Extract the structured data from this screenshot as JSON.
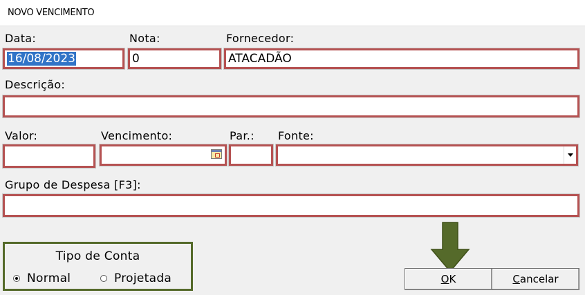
{
  "window": {
    "title": "NOVO VENCIMENTO"
  },
  "labels": {
    "data": "Data:",
    "nota": "Nota:",
    "fornecedor": "Fornecedor:",
    "descricao": "Descrição:",
    "valor": "Valor:",
    "vencimento": "Vencimento:",
    "par": "Par.:",
    "fonte": "Fonte:",
    "grupo": "Grupo de Despesa [F3]:"
  },
  "fields": {
    "data": "16/08/2023",
    "nota": "0",
    "fornecedor": "ATACADÃO",
    "descricao": "",
    "valor": "",
    "vencimento": "",
    "par": "",
    "fonte": "",
    "grupo": ""
  },
  "tipo_conta": {
    "title": "Tipo de Conta",
    "options": [
      "Normal",
      "Projetada"
    ],
    "selected": "Normal"
  },
  "buttons": {
    "ok_accel": "O",
    "ok_rest": "K",
    "cancel_accel": "C",
    "cancel_rest": "ancelar"
  },
  "annotations": {
    "highlight_color": "#b55252",
    "groupbox_color": "#556a2a",
    "arrow_color": "#556a2a"
  },
  "icons": {
    "date_picker": "calendar-icon",
    "dropdown": "chevron-down-icon",
    "pointer": "down-arrow-icon"
  }
}
